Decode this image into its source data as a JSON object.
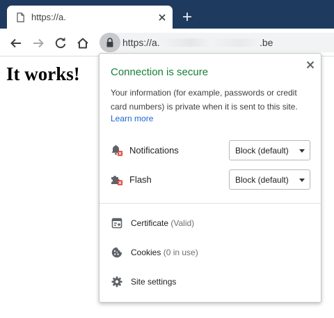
{
  "tab": {
    "title": "https://a.",
    "favicon_icon": "page-icon",
    "close_icon": "close-icon"
  },
  "new_tab_icon": "plus-icon",
  "toolbar": {
    "back_icon": "back-arrow-icon",
    "forward_icon": "forward-arrow-icon",
    "reload_icon": "reload-icon",
    "home_icon": "home-icon",
    "lock_icon": "lock-icon",
    "url_start": "https://a.",
    "url_end": ".be"
  },
  "page": {
    "heading": "It works!"
  },
  "site_info": {
    "title": "Connection is secure",
    "description": "Your information (for example, passwords or credit card numbers) is private when it is sent to this site.",
    "learn_more": "Learn more",
    "close_icon": "close-icon",
    "permissions": [
      {
        "label": "Notifications",
        "value": "Block (default)",
        "icon": "blocked-notifications-icon"
      },
      {
        "label": "Flash",
        "value": "Block (default)",
        "icon": "blocked-plugin-icon"
      }
    ],
    "items": [
      {
        "label": "Certificate",
        "detail": "(Valid)",
        "icon": "certificate-icon"
      },
      {
        "label": "Cookies",
        "detail": "(0 in use)",
        "icon": "cookie-icon"
      },
      {
        "label": "Site settings",
        "detail": "",
        "icon": "gear-icon"
      }
    ]
  },
  "colors": {
    "tab_strip": "#1f3a5f",
    "secure_green": "#188038",
    "link_blue": "#1967d2",
    "blocked_red": "#d93025"
  }
}
